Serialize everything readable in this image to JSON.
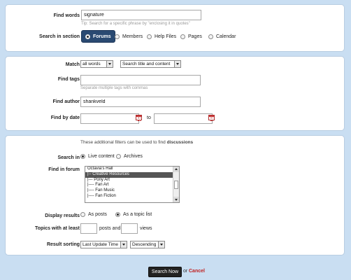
{
  "keyword": {
    "label": "Find words",
    "value": "signature",
    "tip": "Tip: Search for a specific phrase by \"enclosing it in quotes\""
  },
  "section": {
    "label": "Search in section",
    "options": [
      "Forums",
      "Members",
      "Help Files",
      "Pages",
      "Calendar"
    ],
    "selected": "Forums"
  },
  "match": {
    "label": "Match",
    "mode": "all words",
    "scope": "Search title and content"
  },
  "tags": {
    "label": "Find tags",
    "value": "",
    "hint": "Separate multiple tags with commas"
  },
  "author": {
    "label": "Find author",
    "value": "shankveld"
  },
  "date": {
    "label": "Find by date",
    "from": "",
    "to_label": "to",
    "to": ""
  },
  "filters": {
    "note_prefix": "These additional filters can be used to find ",
    "note_bold": "discussions",
    "search_in": {
      "label": "Search in",
      "options": [
        "Live content",
        "Archives"
      ],
      "selected": "Live content"
    },
    "forum": {
      "label": "Find in forum",
      "items": [
        "Octavia's Hall",
        "|-- Creative Resources",
        "|--- Pony Art",
        "|---- Fan Art",
        "|---- Fan Music",
        "|---- Fan Fiction"
      ],
      "selected": "|-- Creative Resources"
    },
    "display": {
      "label": "Display results",
      "options": [
        "As posts",
        "As a topic list"
      ],
      "selected": "As a topic list"
    },
    "topics": {
      "label": "Topics with at least",
      "posts_value": "",
      "posts_and": "posts and",
      "views_value": "",
      "views": "views"
    },
    "sorting": {
      "label": "Result sorting",
      "field": "Last Update Time",
      "order": "Descending"
    }
  },
  "actions": {
    "submit": "Search Now",
    "or": "or",
    "cancel": "Cancel"
  },
  "colors": {
    "page_bg": "#c9def2",
    "active_tab": "#2a4a72",
    "cancel_link": "#c02020",
    "listbox_selected": "#555555"
  }
}
